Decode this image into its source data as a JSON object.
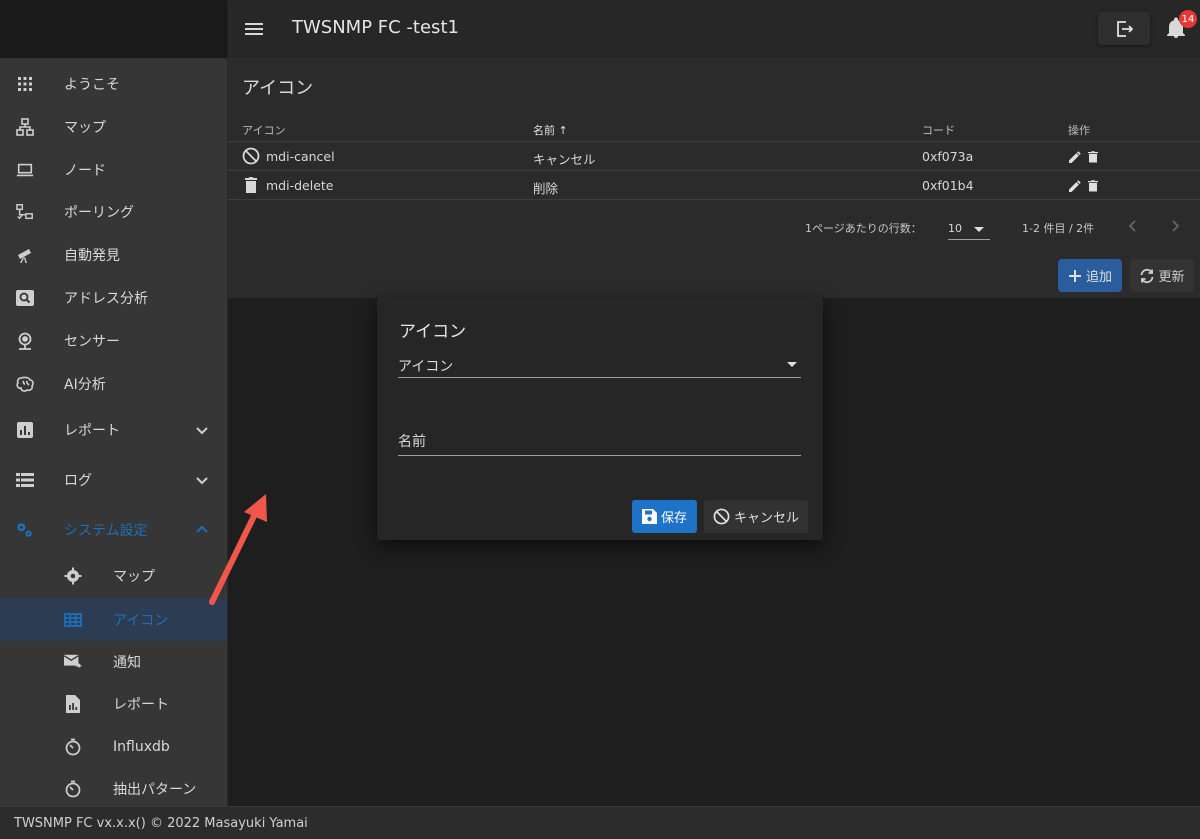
{
  "app": {
    "title": "TWSNMP FC -test1",
    "notification_count": "14"
  },
  "sidebar": {
    "items": [
      {
        "label": "ようこそ",
        "icon": "apps-icon"
      },
      {
        "label": "マップ",
        "icon": "lan-icon"
      },
      {
        "label": "ノード",
        "icon": "laptop-icon"
      },
      {
        "label": "ポーリング",
        "icon": "lan-check-icon"
      },
      {
        "label": "自動発見",
        "icon": "telescope-icon"
      },
      {
        "label": "アドレス分析",
        "icon": "magnify-scan-icon"
      },
      {
        "label": "センサー",
        "icon": "webcam-icon"
      },
      {
        "label": "AI分析",
        "icon": "brain-icon"
      },
      {
        "label": "レポート",
        "icon": "chart-box-icon"
      },
      {
        "label": "ログ",
        "icon": "view-list-icon"
      },
      {
        "label": "システム設定",
        "icon": "cogs-icon"
      }
    ],
    "subitems": [
      {
        "label": "マップ",
        "icon": "cog-icon"
      },
      {
        "label": "アイコン",
        "icon": "grid-icon"
      },
      {
        "label": "通知",
        "icon": "email-send-icon"
      },
      {
        "label": "レポート",
        "icon": "file-chart-icon"
      },
      {
        "label": "Influxdb",
        "icon": "timer-icon"
      },
      {
        "label": "抽出パターン",
        "icon": "timer-icon"
      }
    ]
  },
  "page": {
    "title": "アイコン",
    "columns": [
      "アイコン",
      "名前",
      "コード",
      "操作"
    ],
    "sort_indicator": "↑",
    "rows": [
      {
        "icon": "cancel-icon",
        "icon_name": "mdi-cancel",
        "name": "キャンセル",
        "code": "0xf073a"
      },
      {
        "icon": "delete-icon",
        "icon_name": "mdi-delete",
        "name": "削除",
        "code": "0xf01b4"
      }
    ],
    "pagination": {
      "rows_per_page_label": "1ページあたりの行数：",
      "rows_per_page": "10",
      "range": "1-2 件目 / 2件"
    },
    "add_label": "追加",
    "refresh_label": "更新"
  },
  "dialog": {
    "title": "アイコン",
    "icon_field_label": "アイコン",
    "name_field_label": "名前",
    "save_label": "保存",
    "cancel_label": "キャンセル"
  },
  "footer": {
    "text": "TWSNMP FC vx.x.x() © 2022 Masayuki Yamai"
  },
  "colors": {
    "accent": "#1e73c8",
    "active_nav": "#1e6fb8",
    "badge": "#e53935",
    "annotation_arrow": "#f0574a"
  }
}
